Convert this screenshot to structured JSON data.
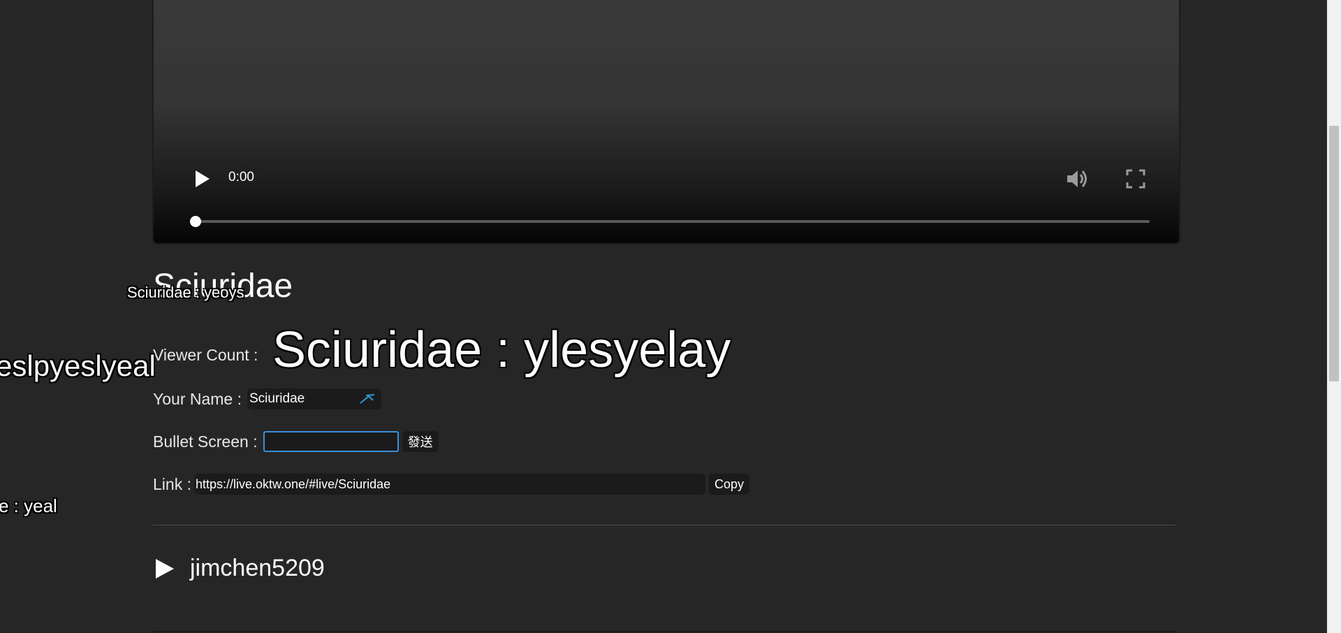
{
  "player": {
    "time": "0:00",
    "progress": 0
  },
  "stream": {
    "title": "Sciuridae"
  },
  "info": {
    "viewer_label": "Viewer Count :",
    "name_label": "Your Name :",
    "name_value": "Sciuridae",
    "bullet_label": "Bullet Screen :",
    "bullet_placeholder": "",
    "send_label": "發送",
    "link_label": "Link :",
    "link_value": "https://live.oktw.one/#live/Sciuridae",
    "copy_label": "Copy"
  },
  "other_streams": [
    {
      "name": "jimchen5209"
    }
  ],
  "danmaku": [
    {
      "text": "Sciuridae : ylesyelay"
    },
    {
      "text": "Sciuridae : yeoys"
    },
    {
      "text": "eslpyeslyeal"
    },
    {
      "text": "e : yeal"
    }
  ],
  "colors": {
    "background": "#262626",
    "field": "#1b1b1b",
    "focus_border": "#3b8fd9",
    "edit_icon": "#2a9bd8"
  }
}
